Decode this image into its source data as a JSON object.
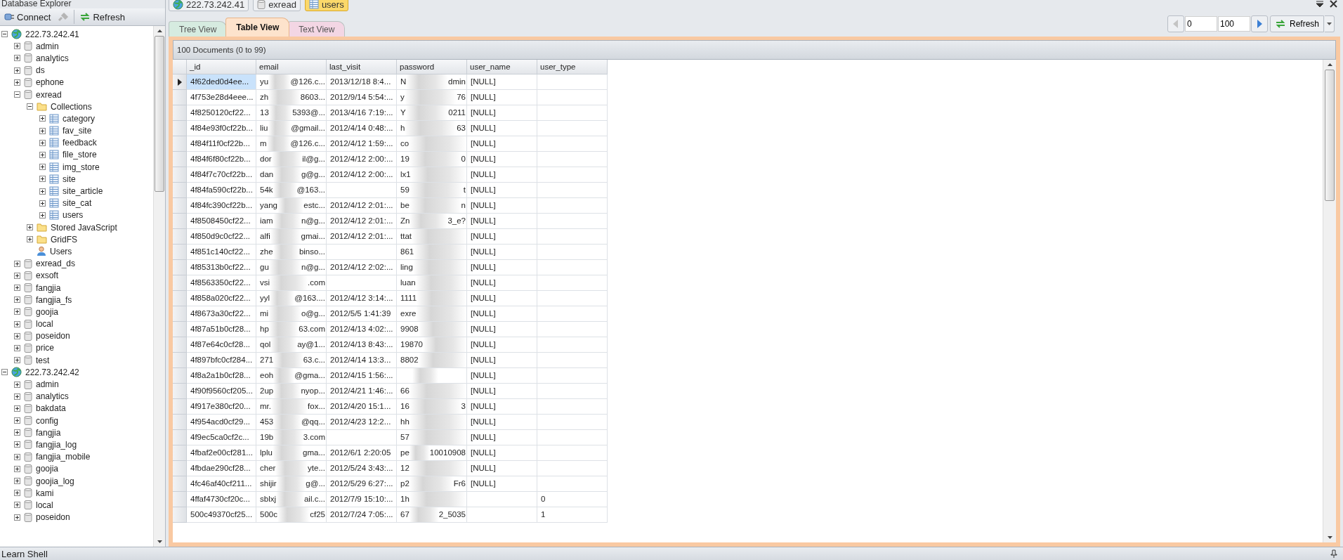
{
  "explorer": {
    "title": "Database Explorer",
    "connect": "Connect",
    "refresh": "Refresh",
    "tree": [
      {
        "label": "222.73.242.41",
        "kind": "server",
        "expanded": true,
        "children": [
          {
            "label": "admin",
            "kind": "database",
            "expanded": false
          },
          {
            "label": "analytics",
            "kind": "database",
            "expanded": false
          },
          {
            "label": "ds",
            "kind": "database",
            "expanded": false
          },
          {
            "label": "ephone",
            "kind": "database",
            "expanded": false
          },
          {
            "label": "exread",
            "kind": "database",
            "expanded": true,
            "children": [
              {
                "label": "Collections",
                "kind": "folder",
                "expanded": true,
                "children": [
                  {
                    "label": "category",
                    "kind": "collection",
                    "expanded": false
                  },
                  {
                    "label": "fav_site",
                    "kind": "collection",
                    "expanded": false
                  },
                  {
                    "label": "feedback",
                    "kind": "collection",
                    "expanded": false
                  },
                  {
                    "label": "file_store",
                    "kind": "collection",
                    "expanded": false
                  },
                  {
                    "label": "img_store",
                    "kind": "collection",
                    "expanded": false
                  },
                  {
                    "label": "site",
                    "kind": "collection",
                    "expanded": false
                  },
                  {
                    "label": "site_article",
                    "kind": "collection",
                    "expanded": false
                  },
                  {
                    "label": "site_cat",
                    "kind": "collection",
                    "expanded": false
                  },
                  {
                    "label": "users",
                    "kind": "collection",
                    "expanded": false
                  }
                ]
              },
              {
                "label": "Stored JavaScript",
                "kind": "folder",
                "expanded": false
              },
              {
                "label": "GridFS",
                "kind": "folder",
                "expanded": false
              },
              {
                "label": "Users",
                "kind": "user"
              }
            ]
          },
          {
            "label": "exread_ds",
            "kind": "database",
            "expanded": false
          },
          {
            "label": "exsoft",
            "kind": "database",
            "expanded": false
          },
          {
            "label": "fangjia",
            "kind": "database",
            "expanded": false
          },
          {
            "label": "fangjia_fs",
            "kind": "database",
            "expanded": false
          },
          {
            "label": "goojia",
            "kind": "database",
            "expanded": false
          },
          {
            "label": "local",
            "kind": "database",
            "expanded": false
          },
          {
            "label": "poseidon",
            "kind": "database",
            "expanded": false
          },
          {
            "label": "price",
            "kind": "database",
            "expanded": false
          },
          {
            "label": "test",
            "kind": "database",
            "expanded": false
          }
        ]
      },
      {
        "label": "222.73.242.42",
        "kind": "server",
        "expanded": true,
        "children": [
          {
            "label": "admin",
            "kind": "database",
            "expanded": false
          },
          {
            "label": "analytics",
            "kind": "database",
            "expanded": false
          },
          {
            "label": "bakdata",
            "kind": "database",
            "expanded": false
          },
          {
            "label": "config",
            "kind": "database",
            "expanded": false
          },
          {
            "label": "fangjia",
            "kind": "database",
            "expanded": false
          },
          {
            "label": "fangjia_log",
            "kind": "database",
            "expanded": false
          },
          {
            "label": "fangjia_mobile",
            "kind": "database",
            "expanded": false
          },
          {
            "label": "goojia",
            "kind": "database",
            "expanded": false
          },
          {
            "label": "goojia_log",
            "kind": "database",
            "expanded": false
          },
          {
            "label": "kami",
            "kind": "database",
            "expanded": false
          },
          {
            "label": "local",
            "kind": "database",
            "expanded": false
          },
          {
            "label": "poseidon",
            "kind": "database",
            "expanded": false
          }
        ]
      }
    ]
  },
  "breadcrumb": [
    {
      "label": "222.73.242.41",
      "kind": "server",
      "selected": false
    },
    {
      "label": "exread",
      "kind": "database",
      "selected": false
    },
    {
      "label": "users",
      "kind": "collection",
      "selected": true
    }
  ],
  "view_tabs": [
    {
      "label": "Tree View",
      "selected": false,
      "color": "#d6ebe0"
    },
    {
      "label": "Table View",
      "selected": true,
      "color": "#fde3cc"
    },
    {
      "label": "Text View",
      "selected": false,
      "color": "#f3d6e4"
    }
  ],
  "pager": {
    "start": "0",
    "count": "100",
    "refresh": "Refresh"
  },
  "documents": {
    "summary": "100 Documents (0 to 99)",
    "columns": [
      "_id",
      "email",
      "last_visit",
      "password",
      "user_name",
      "user_type"
    ],
    "rows": [
      {
        "selected": true,
        "id": "4f62ded0d4ee...",
        "email": {
          "head": "yu",
          "tail": "@126.c..."
        },
        "last_visit": "2013/12/18 8:4...",
        "password": {
          "head": "N",
          "tail": "dmin"
        },
        "user_name": "[NULL]"
      },
      {
        "selected": false,
        "id": "4f753e28d4eee...",
        "email": {
          "head": "zh",
          "tail": "8603..."
        },
        "last_visit": "2012/9/14 5:54:...",
        "password": {
          "head": "y",
          "tail": "76"
        },
        "user_name": "[NULL]"
      },
      {
        "selected": false,
        "id": "4f8250120cf22...",
        "email": {
          "head": "13",
          "tail": "5393@..."
        },
        "last_visit": "2013/4/16 7:19:...",
        "password": {
          "head": "Y",
          "tail": "0211"
        },
        "user_name": "[NULL]"
      },
      {
        "selected": false,
        "id": "4f84e93f0cf22b...",
        "email": {
          "head": "liu",
          "tail": "@gmail..."
        },
        "last_visit": "2012/4/14 0:48:...",
        "password": {
          "head": "h",
          "tail": "63"
        },
        "user_name": "[NULL]"
      },
      {
        "selected": false,
        "id": "4f84f11f0cf22b...",
        "email": {
          "head": "m",
          "tail": "@126.c..."
        },
        "last_visit": "2012/4/12 1:59:...",
        "password": {
          "head": "co"
        },
        "user_name": "[NULL]"
      },
      {
        "selected": false,
        "id": "4f84f6f80cf22b...",
        "email": {
          "head": "dor",
          "tail": "il@g..."
        },
        "last_visit": "2012/4/12 2:00:...",
        "password": {
          "head": "19",
          "tail": "0"
        },
        "user_name": "[NULL]"
      },
      {
        "selected": false,
        "id": "4f84f7c70cf22b...",
        "email": {
          "head": "dan",
          "tail": "g@g..."
        },
        "last_visit": "2012/4/12 2:00:...",
        "password": {
          "head": "lx1"
        },
        "user_name": "[NULL]"
      },
      {
        "selected": false,
        "id": "4f84fa590cf22b...",
        "email": {
          "head": "54k",
          "tail": "@163..."
        },
        "password": {
          "head": "59",
          "tail": "t"
        },
        "user_name": "[NULL]"
      },
      {
        "selected": false,
        "id": "4f84fc390cf22b...",
        "email": {
          "head": "yang",
          "tail": "estc..."
        },
        "last_visit": "2012/4/12 2:01:...",
        "password": {
          "head": "be",
          "tail": "n"
        },
        "user_name": "[NULL]"
      },
      {
        "selected": false,
        "id": "4f8508450cf22...",
        "email": {
          "head": "iam",
          "tail": "n@g..."
        },
        "last_visit": "2012/4/12 2:01:...",
        "password": {
          "head": "Zn",
          "tail": "3_e?"
        },
        "user_name": "[NULL]"
      },
      {
        "selected": false,
        "id": "4f850d9c0cf22...",
        "email": {
          "head": "alfi",
          "tail": "gmai..."
        },
        "last_visit": "2012/4/12 2:01:...",
        "password": {
          "head": "ttat"
        },
        "user_name": "[NULL]"
      },
      {
        "selected": false,
        "id": "4f851c140cf22...",
        "email": {
          "head": "zhe",
          "tail": "binso..."
        },
        "password": {
          "head": "861"
        },
        "user_name": "[NULL]"
      },
      {
        "selected": false,
        "id": "4f85313b0cf22...",
        "email": {
          "head": "gu",
          "tail": "n@g..."
        },
        "last_visit": "2012/4/12 2:02:...",
        "password": {
          "head": "ling"
        },
        "user_name": "[NULL]"
      },
      {
        "selected": false,
        "id": "4f8563350cf22...",
        "email": {
          "head": "vsi",
          "tail": ".com"
        },
        "password": {
          "head": "luan"
        },
        "user_name": "[NULL]"
      },
      {
        "selected": false,
        "id": "4f858a020cf22...",
        "email": {
          "head": "yyl",
          "tail": "@163...."
        },
        "last_visit": "2012/4/12 3:14:...",
        "password": {
          "head": "1111"
        },
        "user_name": "[NULL]"
      },
      {
        "selected": false,
        "id": "4f8673a30cf22...",
        "email": {
          "head": "mi",
          "tail": "o@g..."
        },
        "last_visit": "2012/5/5 1:41:39",
        "password": {
          "head": "exre"
        },
        "user_name": "[NULL]"
      },
      {
        "selected": false,
        "id": "4f87a51b0cf28...",
        "email": {
          "head": "hp",
          "tail": "63.com"
        },
        "last_visit": "2012/4/13 4:02:...",
        "password": {
          "head": "9908"
        },
        "user_name": "[NULL]"
      },
      {
        "selected": false,
        "id": "4f87e64c0cf28...",
        "email": {
          "head": "qol",
          "tail": "ay@1..."
        },
        "last_visit": "2012/4/13 8:43:...",
        "password": {
          "head": "19870"
        },
        "user_name": "[NULL]"
      },
      {
        "selected": false,
        "id": "4f897bfc0cf284...",
        "email": {
          "head": "271",
          "tail": "63.c..."
        },
        "last_visit": "2012/4/14 13:3...",
        "password": {
          "head": "8802"
        },
        "user_name": "[NULL]"
      },
      {
        "selected": false,
        "id": "4f8a2a1b0cf28...",
        "email": {
          "head": "eoh",
          "tail": "@gma..."
        },
        "last_visit": "2012/4/15 1:56:...",
        "user_name": "[NULL]"
      },
      {
        "selected": false,
        "id": "4f90f9560cf205...",
        "email": {
          "head": "2up",
          "tail": "nyop..."
        },
        "last_visit": "2012/4/21 1:46:...",
        "password": {
          "head": "66"
        },
        "user_name": "[NULL]"
      },
      {
        "selected": false,
        "id": "4f917e380cf20...",
        "email": {
          "head": "mr.",
          "tail": "fox..."
        },
        "last_visit": "2012/4/20 15:1...",
        "password": {
          "head": "16",
          "tail": "3"
        },
        "user_name": "[NULL]"
      },
      {
        "selected": false,
        "id": "4f954acd0cf29...",
        "email": {
          "head": "453",
          "tail": "@qq..."
        },
        "last_visit": "2012/4/23 12:2...",
        "password": {
          "head": "hh"
        },
        "user_name": "[NULL]"
      },
      {
        "selected": false,
        "id": "4f9ec5ca0cf2c...",
        "email": {
          "head": "19b",
          "tail": "3.com"
        },
        "password": {
          "head": "57"
        },
        "user_name": "[NULL]"
      },
      {
        "selected": false,
        "id": "4fbaf2e00cf281...",
        "email": {
          "head": "lplu",
          "tail": "gma..."
        },
        "last_visit": "2012/6/1 2:20:05",
        "password": {
          "head": "pe",
          "tail": "10010908"
        },
        "user_name": "[NULL]"
      },
      {
        "selected": false,
        "id": "4fbdae290cf28...",
        "email": {
          "head": "cher",
          "tail": "yte..."
        },
        "last_visit": "2012/5/24 3:43:...",
        "password": {
          "head": "12"
        },
        "user_name": "[NULL]"
      },
      {
        "selected": false,
        "id": "4fc46af40cf211...",
        "email": {
          "head": "shijir",
          "tail": "g@..."
        },
        "last_visit": "2012/5/29 6:27:...",
        "password": {
          "head": "p2",
          "tail": "Fr6"
        },
        "user_name": "[NULL]"
      },
      {
        "selected": false,
        "id": "4ffaf4730cf20c...",
        "email": {
          "head": "sblxj",
          "tail": "ail.c..."
        },
        "last_visit": "2012/7/9 15:10:...",
        "password": {
          "head": "1h"
        },
        "user_type": "0"
      },
      {
        "selected": false,
        "id": "500c49370cf25...",
        "email": {
          "head": "500c",
          "tail": "cf25"
        },
        "last_visit": "2012/7/24 7:05:...",
        "password": {
          "head": "67",
          "tail": "2_5035"
        },
        "user_type": "1"
      }
    ]
  },
  "status_bar": {
    "label": "Learn Shell"
  }
}
